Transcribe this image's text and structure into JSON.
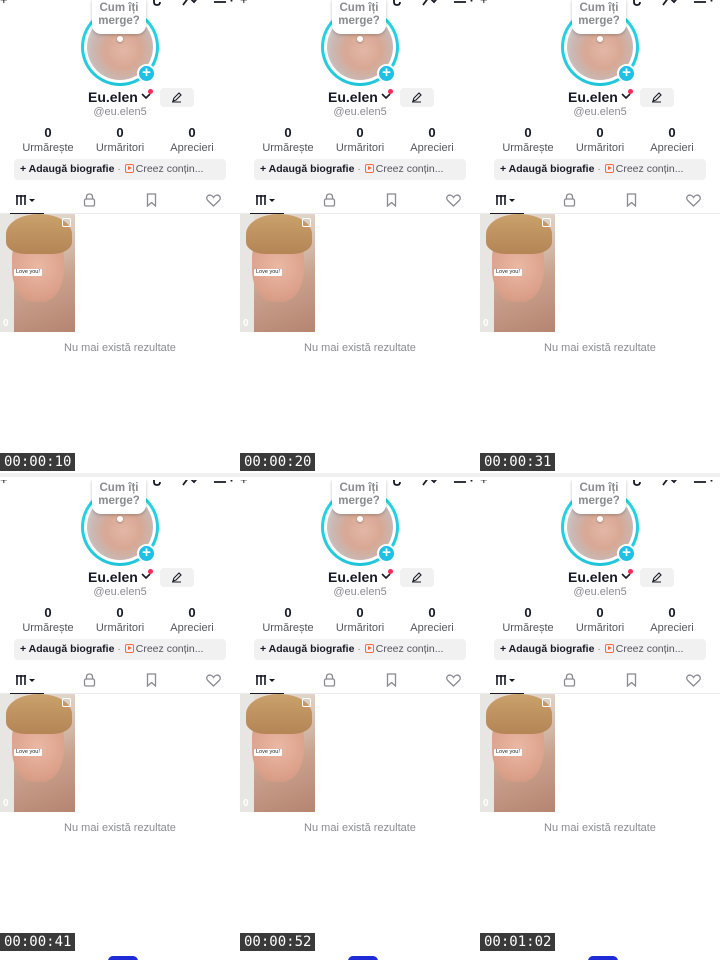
{
  "profile": {
    "bubble_line1": "Cum îți",
    "bubble_line2": "merge?",
    "username": "Eu.elen",
    "handle": "@eu.elen5",
    "stats": [
      {
        "value": "0",
        "label": "Urmărește"
      },
      {
        "value": "0",
        "label": "Urmăritori"
      },
      {
        "value": "0",
        "label": "Aprecieri"
      }
    ],
    "bio_add": "+ Adaugă biografie",
    "bio_separator": "·",
    "creator_label": "Creez conțin...",
    "video": {
      "caption": "Love you!",
      "views": "0"
    },
    "empty_text": "Nu mai există rezultate"
  },
  "frames": [
    {
      "timestamp": "00:00:10"
    },
    {
      "timestamp": "00:00:20"
    },
    {
      "timestamp": "00:00:31"
    },
    {
      "timestamp": "00:00:41"
    },
    {
      "timestamp": "00:00:52"
    },
    {
      "timestamp": "00:01:02"
    }
  ],
  "icons": {
    "top_left": "plus-icon",
    "top_right": [
      "tiktok-studio-icon",
      "analytics-icon",
      "menu-icon"
    ],
    "tabs": [
      "videos-grid-icon",
      "lock-icon",
      "bookmark-icon",
      "heart-icon"
    ],
    "edit": "pencil-icon",
    "avatar_add": "add-story-icon"
  },
  "colors": {
    "ring": "#25d9e6",
    "add_badge": "#20c0e6",
    "notification_dot": "#fe2c55",
    "creator_icon": "#fe6a35",
    "muted_text": "#8a8b91"
  }
}
